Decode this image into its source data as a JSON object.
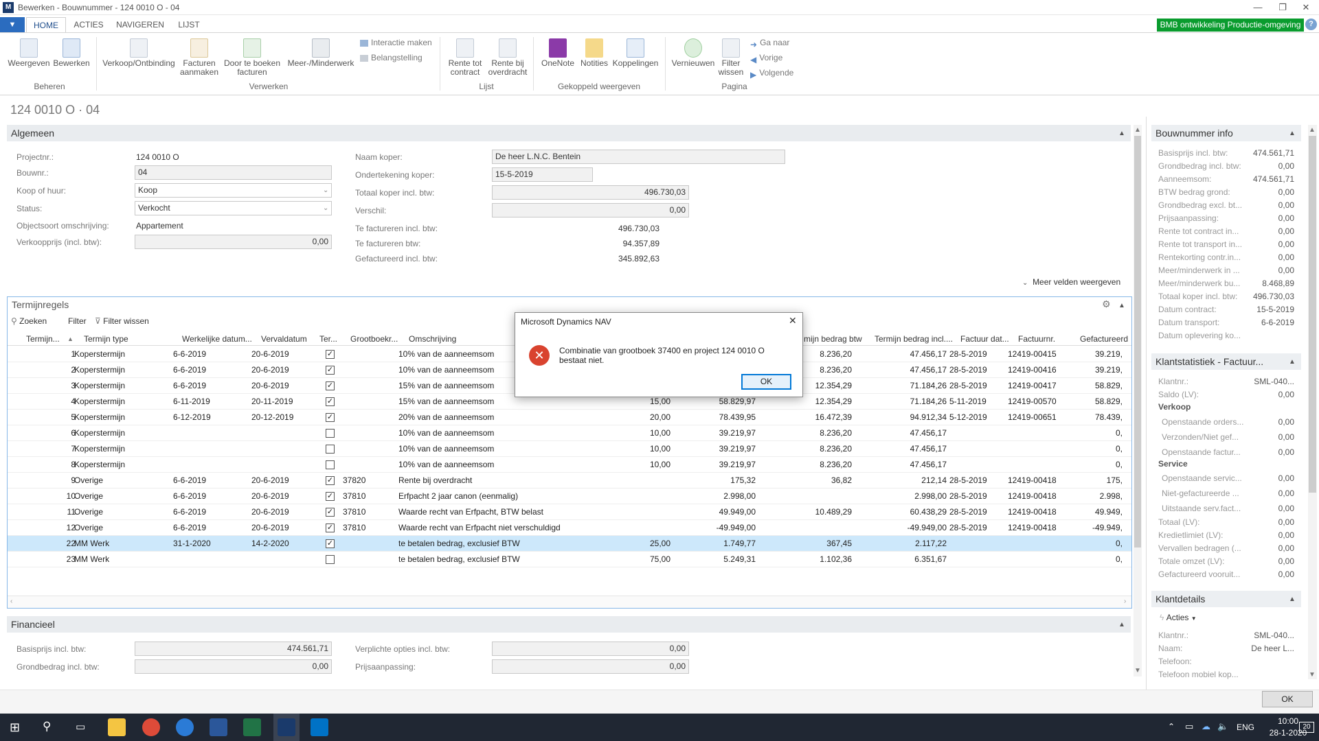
{
  "window": {
    "title": "Bewerken - Bouwnummer - 124 0010 O - 04",
    "logo": "nav-logo"
  },
  "ribbon": {
    "menu_label": "▼",
    "tabs": [
      "HOME",
      "ACTIES",
      "NAVIGEREN",
      "LIJST"
    ],
    "env_badge": "BMB ontwikkeling Productie-omgeving",
    "help": "?",
    "buttons": {
      "weergeven": "Weergeven",
      "bewerken": "Bewerken",
      "verkoop": "Verkoop/Ontbinding",
      "facturen1": "Facturen",
      "facturen2": "aanmaken",
      "doorte1": "Door te boeken",
      "doorte2": "facturen",
      "meer": "Meer-/Minderwerk",
      "interactie": "Interactie maken",
      "belangstelling": "Belangstelling",
      "rente1a": "Rente tot",
      "rente1b": "contract",
      "rente2a": "Rente bij",
      "rente2b": "overdracht",
      "onenote": "OneNote",
      "notities": "Notities",
      "koppelingen": "Koppelingen",
      "vernieuwen": "Vernieuwen",
      "filter1": "Filter",
      "filter2": "wissen",
      "ganaar": "Ga naar",
      "vorige": "Vorige",
      "volgende": "Volgende"
    },
    "groups": {
      "beheren": "Beheren",
      "verwerken": "Verwerken",
      "lijst": "Lijst",
      "gekoppeld": "Gekoppeld weergeven",
      "pagina": "Pagina"
    }
  },
  "page": {
    "title": "124 0010 O · 04"
  },
  "algemeen": {
    "header": "Algemeen",
    "projectnr_label": "Projectnr.:",
    "projectnr": "124 0010 O",
    "bouwnr_label": "Bouwnr.:",
    "bouwnr": "04",
    "koop_label": "Koop of huur:",
    "koop": "Koop",
    "status_label": "Status:",
    "status": "Verkocht",
    "objectsoort_label": "Objectsoort omschrijving:",
    "objectsoort": "Appartement",
    "verkoopprijs_label": "Verkoopprijs (incl. btw):",
    "verkoopprijs": "0,00",
    "naam_label": "Naam koper:",
    "naam": "De heer L.N.C. Bentein",
    "ondertekening_label": "Ondertekening koper:",
    "ondertekening": "15-5-2019",
    "totaal_label": "Totaal koper incl. btw:",
    "totaal": "496.730,03",
    "verschil_label": "Verschil:",
    "verschil": "0,00",
    "tefact_incl_label": "Te factureren incl. btw:",
    "tefact_incl": "496.730,03",
    "tefact_btw_label": "Te factureren btw:",
    "tefact_btw": "94.357,89",
    "gefact_label": "Gefactureerd incl. btw:",
    "gefact": "345.892,63",
    "meer_velden": "Meer velden weergeven"
  },
  "termijn": {
    "header": "Termijnregels",
    "toolbar": {
      "zoeken": "Zoeken",
      "filter": "Filter",
      "filter_wissen": "Filter wissen"
    },
    "columns": [
      "Termijn...",
      "Termijn type",
      "Werkelijke datum...",
      "Vervaldatum",
      "Ter...",
      "Grootboekr...",
      "Omschrijving",
      "mijn bedrag btw",
      "Termijn bedrag incl....",
      "Factuur dat...",
      "Factuurnr.",
      "Gefactureerd b"
    ],
    "rows": [
      {
        "nr": "1",
        "type": "Koperstermijn",
        "werk": "6-6-2019",
        "verval": "20-6-2019",
        "check": "☑",
        "gb": "",
        "oms": "10% van de aanneemsom",
        "pct": "",
        "bedrag": "",
        "btw": "8.236,20",
        "incl": "47.456,17",
        "fdat": "28-5-2019",
        "fnr": "12419-00415",
        "gef": "39.219,"
      },
      {
        "nr": "2",
        "type": "Koperstermijn",
        "werk": "6-6-2019",
        "verval": "20-6-2019",
        "check": "☑",
        "gb": "",
        "oms": "10% van de aanneemsom",
        "pct": "",
        "bedrag": "",
        "btw": "8.236,20",
        "incl": "47.456,17",
        "fdat": "28-5-2019",
        "fnr": "12419-00416",
        "gef": "39.219,"
      },
      {
        "nr": "3",
        "type": "Koperstermijn",
        "werk": "6-6-2019",
        "verval": "20-6-2019",
        "check": "☑",
        "gb": "",
        "oms": "15% van de aanneemsom",
        "pct": "",
        "bedrag": "",
        "btw": "12.354,29",
        "incl": "71.184,26",
        "fdat": "28-5-2019",
        "fnr": "12419-00417",
        "gef": "58.829,"
      },
      {
        "nr": "4",
        "type": "Koperstermijn",
        "werk": "6-11-2019",
        "verval": "20-11-2019",
        "check": "☑",
        "gb": "",
        "oms": "15% van de aanneemsom",
        "pct": "15,00",
        "bedrag": "58.829,97",
        "btw": "12.354,29",
        "incl": "71.184,26",
        "fdat": "5-11-2019",
        "fnr": "12419-00570",
        "gef": "58.829,"
      },
      {
        "nr": "5",
        "type": "Koperstermijn",
        "werk": "6-12-2019",
        "verval": "20-12-2019",
        "check": "☑",
        "gb": "",
        "oms": "20% van de aanneemsom",
        "pct": "20,00",
        "bedrag": "78.439,95",
        "btw": "16.472,39",
        "incl": "94.912,34",
        "fdat": "5-12-2019",
        "fnr": "12419-00651",
        "gef": "78.439,"
      },
      {
        "nr": "6",
        "type": "Koperstermijn",
        "werk": "",
        "verval": "",
        "check": "☐",
        "gb": "",
        "oms": "10% van de aanneemsom",
        "pct": "10,00",
        "bedrag": "39.219,97",
        "btw": "8.236,20",
        "incl": "47.456,17",
        "fdat": "",
        "fnr": "",
        "gef": "0,"
      },
      {
        "nr": "7",
        "type": "Koperstermijn",
        "werk": "",
        "verval": "",
        "check": "☐",
        "gb": "",
        "oms": "10% van de aanneemsom",
        "pct": "10,00",
        "bedrag": "39.219,97",
        "btw": "8.236,20",
        "incl": "47.456,17",
        "fdat": "",
        "fnr": "",
        "gef": "0,"
      },
      {
        "nr": "8",
        "type": "Koperstermijn",
        "werk": "",
        "verval": "",
        "check": "☐",
        "gb": "",
        "oms": "10% van de aanneemsom",
        "pct": "10,00",
        "bedrag": "39.219,97",
        "btw": "8.236,20",
        "incl": "47.456,17",
        "fdat": "",
        "fnr": "",
        "gef": "0,"
      },
      {
        "nr": "9",
        "type": "Overige",
        "werk": "6-6-2019",
        "verval": "20-6-2019",
        "check": "☑",
        "gb": "37820",
        "oms": "Rente bij overdracht",
        "pct": "",
        "bedrag": "175,32",
        "btw": "36,82",
        "incl": "212,14",
        "fdat": "28-5-2019",
        "fnr": "12419-00418",
        "gef": "175,"
      },
      {
        "nr": "10",
        "type": "Overige",
        "werk": "6-6-2019",
        "verval": "20-6-2019",
        "check": "☑",
        "gb": "37810",
        "oms": "Erfpacht 2 jaar canon (eenmalig)",
        "pct": "",
        "bedrag": "2.998,00",
        "btw": "",
        "incl": "2.998,00",
        "fdat": "28-5-2019",
        "fnr": "12419-00418",
        "gef": "2.998,"
      },
      {
        "nr": "11",
        "type": "Overige",
        "werk": "6-6-2019",
        "verval": "20-6-2019",
        "check": "☑",
        "gb": "37810",
        "oms": "Waarde recht van Erfpacht, BTW belast",
        "pct": "",
        "bedrag": "49.949,00",
        "btw": "10.489,29",
        "incl": "60.438,29",
        "fdat": "28-5-2019",
        "fnr": "12419-00418",
        "gef": "49.949,"
      },
      {
        "nr": "12",
        "type": "Overige",
        "werk": "6-6-2019",
        "verval": "20-6-2019",
        "check": "☑",
        "gb": "37810",
        "oms": "Waarde recht van Erfpacht niet verschuldigd",
        "pct": "",
        "bedrag": "-49.949,00",
        "btw": "",
        "incl": "-49.949,00",
        "fdat": "28-5-2019",
        "fnr": "12419-00418",
        "gef": "-49.949,"
      },
      {
        "nr": "22",
        "type": "MM Werk",
        "werk": "31-1-2020",
        "verval": "14-2-2020",
        "check": "☑",
        "gb": "",
        "oms": "te betalen bedrag, exclusief BTW",
        "pct": "25,00",
        "bedrag": "1.749,77",
        "btw": "367,45",
        "incl": "2.117,22",
        "fdat": "",
        "fnr": "",
        "gef": "0,"
      },
      {
        "nr": "23",
        "type": "MM Werk",
        "werk": "",
        "verval": "",
        "check": "☐",
        "gb": "",
        "oms": "te betalen bedrag, exclusief BTW",
        "pct": "75,00",
        "bedrag": "5.249,31",
        "btw": "1.102,36",
        "incl": "6.351,67",
        "fdat": "",
        "fnr": "",
        "gef": "0,"
      }
    ]
  },
  "financieel": {
    "header": "Financieel",
    "basisprijs_label": "Basisprijs incl. btw:",
    "basisprijs": "474.561,71",
    "grondbedrag_label": "Grondbedrag incl. btw:",
    "grondbedrag": "0,00",
    "verplichte_label": "Verplichte opties incl. btw:",
    "verplichte": "0,00",
    "prijsaanpassing_label": "Prijsaanpassing:",
    "prijsaanpassing": "0,00"
  },
  "bouwnummer_info": {
    "header": "Bouwnummer info",
    "items": [
      {
        "label": "Basisprijs incl. btw:",
        "value": "474.561,71"
      },
      {
        "label": "Grondbedrag incl. btw:",
        "value": "0,00"
      },
      {
        "label": "Aanneemsom:",
        "value": "474.561,71"
      },
      {
        "label": "BTW bedrag grond:",
        "value": "0,00"
      },
      {
        "label": "Grondbedrag excl. bt...",
        "value": "0,00"
      },
      {
        "label": "Prijsaanpassing:",
        "value": "0,00"
      },
      {
        "label": "Rente tot contract in...",
        "value": "0,00"
      },
      {
        "label": "Rente tot transport in...",
        "value": "0,00"
      },
      {
        "label": "Rentekorting contr.in...",
        "value": "0,00"
      },
      {
        "label": "Meer/minderwerk in ...",
        "value": "0,00"
      },
      {
        "label": "Meer/minderwerk bu...",
        "value": "8.468,89"
      },
      {
        "label": "Totaal koper incl. btw:",
        "value": "496.730,03"
      },
      {
        "label": "Datum contract:",
        "value": "15-5-2019"
      },
      {
        "label": "Datum transport:",
        "value": "6-6-2019"
      },
      {
        "label": "Datum oplevering ko...",
        "value": ""
      }
    ]
  },
  "klantstat": {
    "header": "Klantstatistiek - Factuur...",
    "klantnr_label": "Klantnr.:",
    "klantnr": "SML-040...",
    "saldo_label": "Saldo (LV):",
    "saldo": "0,00",
    "verkoop": "Verkoop",
    "verkoop_items": [
      {
        "label": "Openstaande orders...",
        "value": "0,00"
      },
      {
        "label": "Verzonden/Niet gef...",
        "value": "0,00"
      },
      {
        "label": "Openstaande factur...",
        "value": "0,00"
      }
    ],
    "service": "Service",
    "service_items": [
      {
        "label": "Openstaande servic...",
        "value": "0,00"
      },
      {
        "label": "Niet-gefactureerde ...",
        "value": "0,00"
      },
      {
        "label": "Uitstaande serv.fact...",
        "value": "0,00"
      }
    ],
    "totaal_label": "Totaal (LV):",
    "totaal": "0,00",
    "rest": [
      {
        "label": "Kredietlimiet (LV):",
        "value": "0,00"
      },
      {
        "label": "Vervallen bedragen (...",
        "value": "0,00"
      },
      {
        "label": "Totale omzet (LV):",
        "value": "0,00"
      },
      {
        "label": "Gefactureerd vooruit...",
        "value": "0,00"
      }
    ]
  },
  "klantdetails": {
    "header": "Klantdetails",
    "acties": "Acties",
    "items": [
      {
        "label": "Klantnr.:",
        "value": "SML-040..."
      },
      {
        "label": "Naam:",
        "value": "De heer L..."
      },
      {
        "label": "Telefoon:",
        "value": ""
      },
      {
        "label": "Telefoon mobiel kop...",
        "value": ""
      }
    ]
  },
  "footer": {
    "ok": "OK"
  },
  "dialog": {
    "title": "Microsoft Dynamics NAV",
    "message": "Combinatie van grootboek 37400 en project 124 0010 O bestaat niet.",
    "ok": "OK"
  },
  "taskbar": {
    "lang": "ENG",
    "time": "10:00",
    "date": "28-1-2020",
    "notifications": "20"
  },
  "colors": {
    "accent": "#2b6cbf",
    "env_badge": "#0a9c2e",
    "error": "#d9432f",
    "selected_row": "#cde8fb"
  }
}
